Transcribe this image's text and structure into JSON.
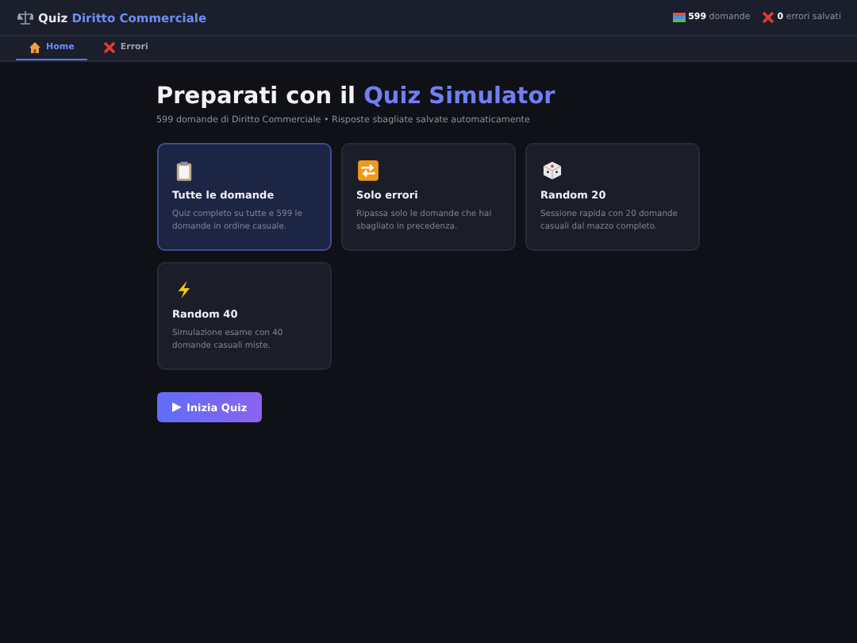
{
  "header": {
    "title_plain": "Quiz",
    "title_accent": "Diritto Commerciale",
    "stats": [
      {
        "value": "599",
        "label": "domande"
      },
      {
        "value": "0",
        "label": "errori salvati"
      }
    ]
  },
  "tabs": [
    {
      "label": "Home",
      "selected": true
    },
    {
      "label": "Errori",
      "selected": false
    }
  ],
  "hero": {
    "title_plain": "Preparati con il",
    "title_accent": "Quiz Simulator",
    "subtitle": "599 domande di Diritto Commerciale • Risposte sbagliate salvate automaticamente"
  },
  "modes": [
    {
      "title": "Tutte le domande",
      "description": "Quiz completo su tutte e 599 le domande in ordine casuale.",
      "selected": true
    },
    {
      "title": "Solo errori",
      "description": "Ripassa solo le domande che hai sbagliato in precedenza.",
      "selected": false
    },
    {
      "title": "Random 20",
      "description": "Sessione rapida con 20 domande casuali dal mazzo completo.",
      "selected": false
    },
    {
      "title": "Random 40",
      "description": "Simulazione esame con 40 domande casuali miste.",
      "selected": false
    }
  ],
  "start_button": {
    "label": "Inizia Quiz"
  }
}
